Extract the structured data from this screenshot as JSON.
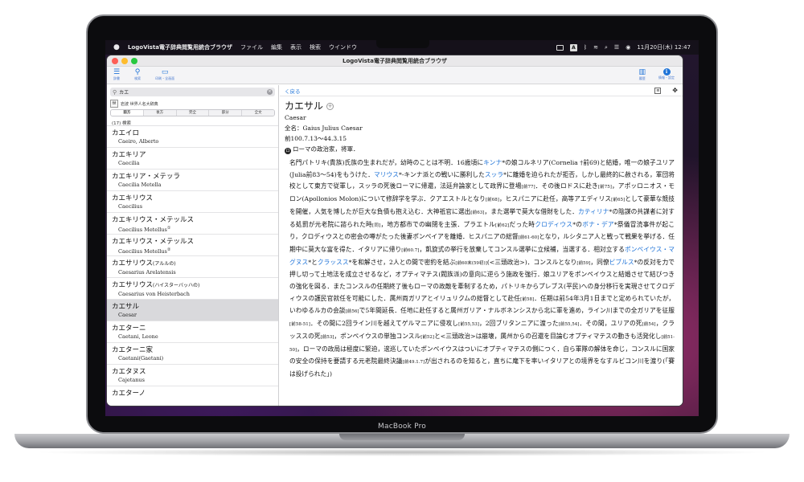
{
  "device": {
    "label": "MacBook Pro"
  },
  "menubar": {
    "app_name": "LogoVista電子辞典閲覧用統合ブラウザ",
    "menus": [
      "ファイル",
      "編集",
      "表示",
      "検索",
      "ウインドウ"
    ],
    "input_indicator": "A",
    "clock": "11月20日(木)  12:47"
  },
  "window": {
    "title": "LogoVista電子辞典閲覧用統合ブラウザ"
  },
  "toolbar": {
    "left": [
      {
        "icon": "list-icon",
        "label": "辞書"
      },
      {
        "icon": "search-icon",
        "label": "検索"
      },
      {
        "icon": "history-icon",
        "label": "印刷・全画面"
      }
    ],
    "right": [
      {
        "icon": "book-icon",
        "label": "履歴"
      },
      {
        "icon": "info-icon",
        "label": "情報・設定"
      }
    ]
  },
  "search": {
    "value": "カエ",
    "placeholder": ""
  },
  "dictionary": {
    "icon_text": "世",
    "name": "岩波 世界人名大辞典"
  },
  "match_modes": [
    {
      "label": "前方",
      "active": true
    },
    {
      "label": "後方",
      "active": false
    },
    {
      "label": "完全",
      "active": false
    },
    {
      "label": "部分",
      "active": false
    },
    {
      "label": "全文",
      "active": false
    }
  ],
  "result_count": "(17)  検索",
  "entries": [
    {
      "kana": "カエイロ",
      "kana_small": "",
      "latin": "Caeiro, Alberto",
      "sup": "",
      "selected": false
    },
    {
      "kana": "カエキリア",
      "kana_small": "",
      "latin": "Caecilia",
      "sup": "",
      "selected": false
    },
    {
      "kana": "カエキリア・メテッラ",
      "kana_small": "",
      "latin": "Caecilia Metella",
      "sup": "",
      "selected": false
    },
    {
      "kana": "カエキリウス",
      "kana_small": "",
      "latin": "Caecilius",
      "sup": "",
      "selected": false
    },
    {
      "kana": "カエキリウス・メテッルス",
      "kana_small": "",
      "latin": "Caecilius Metellus",
      "sup": "①",
      "selected": false
    },
    {
      "kana": "カエキリウス・メテッルス",
      "kana_small": "",
      "latin": "Caecilius Metellus",
      "sup": "②",
      "selected": false
    },
    {
      "kana": "カエサリウス",
      "kana_small": "(アルルの)",
      "latin": "Caesarius Arelatensis",
      "sup": "",
      "selected": false
    },
    {
      "kana": "カエサリウス",
      "kana_small": "(ハイスターバッハの)",
      "latin": "Caesarius von Heisterbach",
      "sup": "",
      "selected": false
    },
    {
      "kana": "カエサル",
      "kana_small": "",
      "latin": "Caesar",
      "sup": "",
      "selected": true
    },
    {
      "kana": "カエターニ",
      "kana_small": "",
      "latin": "Caetani, Leone",
      "sup": "",
      "selected": false
    },
    {
      "kana": "カエターニ家",
      "kana_small": "",
      "latin": "Caetani(Gaetani)",
      "sup": "",
      "selected": false
    },
    {
      "kana": "カエタヌス",
      "kana_small": "",
      "latin": "Cajetanus",
      "sup": "",
      "selected": false
    },
    {
      "kana": "カエターノ",
      "kana_small": "",
      "latin": "",
      "sup": "",
      "selected": false
    }
  ],
  "nav": {
    "back_label": "く戻る"
  },
  "article": {
    "headword": "カエサル",
    "latin": "Caesar",
    "fullname": "全名：Gaius Julius Caesar",
    "dates": "前100.7.13〜44.3.15",
    "role": "ローマの政治家，将軍．",
    "role_icon": "ロ",
    "body": [
      {
        "t": "名門パトリキ(貴族)氏族の生まれだが，幼時のことは不明．16歳頃に"
      },
      {
        "t": "キンナ",
        "link": true
      },
      {
        "t": "*の娘コルネリア(Cornelia †前69)と結婚，唯一の娘子ユリア(Julia前83〜54)をもうけた．"
      },
      {
        "t": "マリウス",
        "link": true
      },
      {
        "t": "*-キンナ派との戦いに勝利した"
      },
      {
        "t": "スッラ",
        "link": true
      },
      {
        "t": "*に離婚を迫られたが拒否，しかし最終的に赦される，軍団将校として東方で従軍し，スッラの死後ローマに帰還，法廷弁論家として政界に登場"
      },
      {
        "t": "[前77]",
        "small": true
      },
      {
        "t": "．その後ロドスに赴き"
      },
      {
        "t": "[前75]",
        "small": true
      },
      {
        "t": "，アポッロニオス・モロン(Apollonios Molon)について修辞学を学ぶ．クアエストルとなり"
      },
      {
        "t": "[前68]",
        "small": true
      },
      {
        "t": "，ヒスパニアに赴任，高等アエディリス"
      },
      {
        "t": "[前65]",
        "small": true
      },
      {
        "t": "として豪華な競技を開催，人気を博したが巨大な負債も抱え込む．大神祇官に選出"
      },
      {
        "t": "[前63]",
        "small": true
      },
      {
        "t": "，また選挙で莫大な借財をした．"
      },
      {
        "t": "カティリナ",
        "link": true
      },
      {
        "t": "*の陰謀の共謀者に対する処罰が元老院に諮られた時"
      },
      {
        "t": "[同]",
        "small": true
      },
      {
        "t": "，地方都市での幽閉を主張．プラエトル"
      },
      {
        "t": "[前62]",
        "small": true
      },
      {
        "t": "だった時"
      },
      {
        "t": "クロディウス",
        "link": true
      },
      {
        "t": "*の"
      },
      {
        "t": "ボナ・デア",
        "link": true
      },
      {
        "t": "*祭儀冒涜事件が起こり，クロディウスとの密会の噂がたった後妻ポンペイアを離婚．ヒスパニアの総督"
      },
      {
        "t": "[前61-60]",
        "small": true
      },
      {
        "t": "となり，ルシタニア人と戦って戦果を挙げる．任期中に莫大な富を得た．イタリアに帰り"
      },
      {
        "t": "[前60.7]",
        "small": true
      },
      {
        "t": "，凱旋式の挙行を放棄してコンスル選挙に立候補，当選する．相対立する"
      },
      {
        "t": "ポンペイウス・マグヌス",
        "link": true
      },
      {
        "t": "*と"
      },
      {
        "t": "クラッスス",
        "link": true
      },
      {
        "t": "*を和解させ，2人との間で密約を結ぶ"
      },
      {
        "t": "[前60末(59初)]",
        "small": true
      },
      {
        "t": "(<三頭政治>)．コンスルとなり"
      },
      {
        "t": "[前59]",
        "small": true
      },
      {
        "t": "，同僚"
      },
      {
        "t": "ビブルス",
        "link": true
      },
      {
        "t": "*の反対を力で押し切って土地法を成立させるなど，オプティマテス(閥族派)の意向に逆らう施政を強行．娘ユリアをポンペイウスと結婚させて結びつきの強化を図る．またコンスルの任期終了後もローマの政敵を牽制するため，パトリキからプレブス(平民)への身分移行を実現させてクロディウスの護民官就任を可能にした．属州両ガリアとイリュリクムの総督として赴任"
      },
      {
        "t": "[前58]",
        "small": true
      },
      {
        "t": "．任期は前54年3月1日までと定められていたが，いわゆるルカの会談"
      },
      {
        "t": "[前56]",
        "small": true
      },
      {
        "t": "で5年間延長．任地に赴任すると属州ガリア・ナルボネンシスから北に軍を進め，ライン川までの全ガリアを征服"
      },
      {
        "t": "[前58-51]",
        "small": true
      },
      {
        "t": "．その間に2回ライン川を越えてゲルマニアに侵攻し"
      },
      {
        "t": "[前55,53]",
        "small": true
      },
      {
        "t": "，2回ブリタンニアに渡った"
      },
      {
        "t": "[前55,54]",
        "small": true
      },
      {
        "t": "．その間，ユリアの死"
      },
      {
        "t": "[前54]",
        "small": true
      },
      {
        "t": "，クラッススの死"
      },
      {
        "t": "[前53]",
        "small": true
      },
      {
        "t": "，ポンペイウスの単独コンスル"
      },
      {
        "t": "[前52]",
        "small": true
      },
      {
        "t": "と<三頭政治>は崩壊，属州からの召還を目論むオプティマテスの動きも活発化し"
      },
      {
        "t": "[前51-50]",
        "small": true
      },
      {
        "t": "，ローマの政局は極度に緊迫，逡巡していたポンペイウスはついにオプティマテスの側につく．自ら軍隊の解体を命じ，コンスルに国家の安全の保持を要請する元老院最終決議"
      },
      {
        "t": "[前49.1.7]",
        "small": true
      },
      {
        "t": "が出されるのを知ると，直ちに麾下を率いイタリアとの境界をなすルビコン川を渡り(「賽は投げられた」)"
      }
    ]
  }
}
